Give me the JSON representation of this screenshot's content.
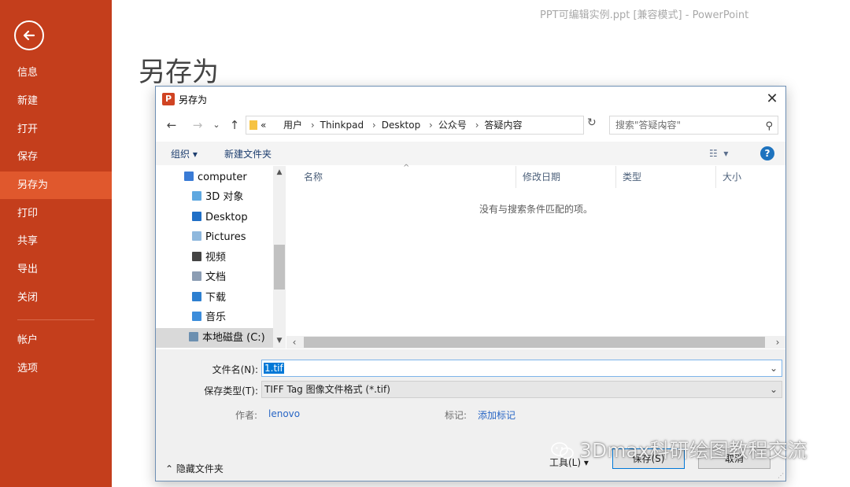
{
  "window": {
    "title": "PPT可编辑实例.ppt [兼容模式] - PowerPoint"
  },
  "backstage": {
    "page_title": "另存为",
    "nav": [
      {
        "label": "信息"
      },
      {
        "label": "新建"
      },
      {
        "label": "打开"
      },
      {
        "label": "保存"
      },
      {
        "label": "另存为",
        "active": true
      },
      {
        "label": "打印"
      },
      {
        "label": "共享"
      },
      {
        "label": "导出"
      },
      {
        "label": "关闭"
      },
      {
        "label": "帐户"
      },
      {
        "label": "选项"
      }
    ],
    "accent_color": "#c43e1c",
    "active_color": "#e0582d"
  },
  "dialog": {
    "title": "另存为",
    "icon": "powerpoint-icon",
    "close_glyph": "✕",
    "address": {
      "prefix": "«",
      "crumbs": [
        "用户",
        "Thinkpad",
        "Desktop",
        "公众号",
        "答疑内容"
      ]
    },
    "search": {
      "placeholder": "搜索\"答疑内容\""
    },
    "toolbar": {
      "organize": "组织 ▾",
      "new_folder": "新建文件夹",
      "help": "?"
    },
    "tree": [
      {
        "label": "computer",
        "icon": "computer-icon",
        "color": "#3a7bd5"
      },
      {
        "label": "3D 对象",
        "icon": "3d-objects-icon",
        "color": "#5fa8e0"
      },
      {
        "label": "Desktop",
        "icon": "desktop-icon",
        "color": "#1f6fc6"
      },
      {
        "label": "Pictures",
        "icon": "pictures-icon",
        "color": "#8fb8dd"
      },
      {
        "label": "视频",
        "icon": "videos-icon",
        "color": "#444444"
      },
      {
        "label": "文档",
        "icon": "documents-icon",
        "color": "#8c9db3"
      },
      {
        "label": "下载",
        "icon": "downloads-icon",
        "color": "#2d7fd0"
      },
      {
        "label": "音乐",
        "icon": "music-icon",
        "color": "#3c8ddb"
      },
      {
        "label": "本地磁盘 (C:)",
        "icon": "drive-icon",
        "color": "#6c8fb0",
        "selected": true
      }
    ],
    "columns": [
      "名称",
      "修改日期",
      "类型",
      "大小"
    ],
    "empty_message": "没有与搜索条件匹配的项。",
    "form": {
      "filename_label": "文件名(N):",
      "filename_value": "1.tif",
      "filetype_label": "保存类型(T):",
      "filetype_value": "TIFF Tag 图像文件格式 (*.tif)",
      "author_label": "作者:",
      "author_value": "lenovo",
      "tags_label": "标记:",
      "tags_value": "添加标记",
      "hide_folders": "隐藏文件夹",
      "tools": "工具(L)",
      "save": "保存(S)",
      "cancel": "取消"
    }
  },
  "watermark": {
    "text": "3Dmax科研绘图教程交流",
    "icon": "wechat-icon"
  }
}
